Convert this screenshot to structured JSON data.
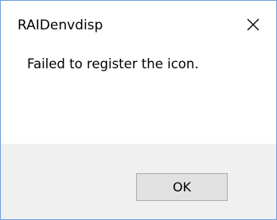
{
  "window": {
    "title": "RAIDenvdisp",
    "close_icon": "close-icon"
  },
  "content": {
    "message": "Failed to register the icon."
  },
  "footer": {
    "ok_label": "OK"
  },
  "colors": {
    "border": "#6f9fd6",
    "footer_bg": "#f0f0f0",
    "button_bg": "#e1e1e1",
    "button_border": "#adadad"
  }
}
